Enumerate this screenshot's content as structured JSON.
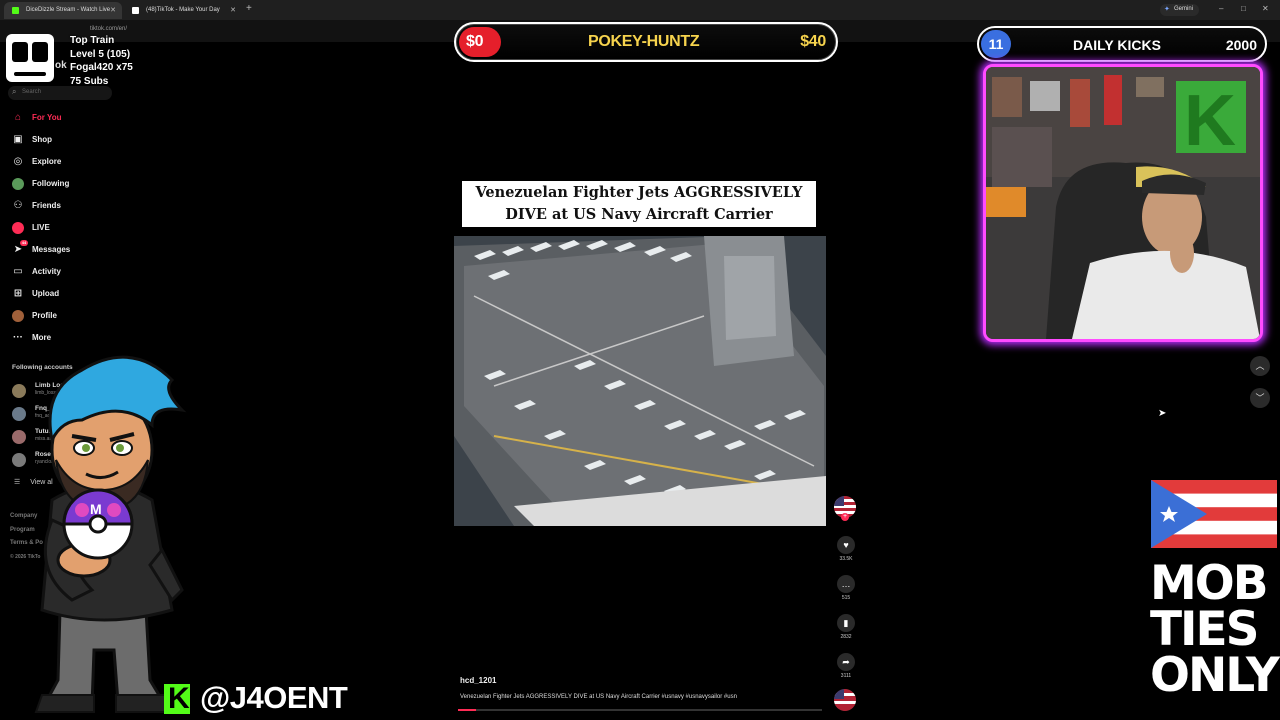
{
  "browser": {
    "tabs": [
      {
        "title": "DiceDizzle Stream - Watch Live",
        "favicon_color": "#53fc18",
        "active": true
      },
      {
        "title": "(48)TikTok - Make Your Day",
        "favicon_color": "#ffffff",
        "active": false
      }
    ],
    "new_tab": "+",
    "gemini_label": "Gemini",
    "url": "tiktok.com/en/"
  },
  "overlay_train": {
    "line1": "Top Train",
    "line2": "Level 5  (105)",
    "line3": "Fogal420 x75",
    "line4": "75 Subs",
    "logo_text": "ok"
  },
  "sidebar": {
    "search_placeholder": "Search",
    "items": [
      {
        "label": "For You",
        "icon": "home-icon",
        "active": true
      },
      {
        "label": "Shop",
        "icon": "shop-icon"
      },
      {
        "label": "Explore",
        "icon": "compass-icon"
      },
      {
        "label": "Following",
        "icon": "following-icon"
      },
      {
        "label": "Friends",
        "icon": "friends-icon"
      },
      {
        "label": "LIVE",
        "icon": "live-icon"
      },
      {
        "label": "Messages",
        "icon": "messages-icon",
        "badge": "44"
      },
      {
        "label": "Activity",
        "icon": "activity-icon"
      },
      {
        "label": "Upload",
        "icon": "upload-icon"
      },
      {
        "label": "Profile",
        "icon": "profile-icon"
      },
      {
        "label": "More",
        "icon": "more-icon"
      }
    ],
    "following_title": "Following accounts",
    "accounts": [
      {
        "name": "Limb Loss Bos",
        "handle": "limb_loss_boss"
      },
      {
        "name": "Fnq_advent",
        "handle": "fnq_adventures"
      },
      {
        "name": "Tutu.sh",
        "handle": "miss.am"
      },
      {
        "name": "Rosecle",
        "handle": "ryancloneb"
      }
    ],
    "view_all": "View al",
    "footer": [
      "Company",
      "Program",
      "Terms & Po",
      "© 2026 TikTo"
    ]
  },
  "streamer": {
    "handle": "@J4OENT"
  },
  "goal_bar": {
    "left_amount": "$0",
    "name": "POKEY-HUNTZ",
    "right_amount": "$40"
  },
  "daily_kicks": {
    "count": "11",
    "title": "DAILY KICKS",
    "goal": "2000"
  },
  "video": {
    "title_line1": "Venezuelan Fighter Jets AGGRESSIVELY",
    "title_line2": "DIVE at US Navy Aircraft Carrier",
    "author": "hcd_1201",
    "caption": "Venezuelan Fighter Jets AGGRESSIVELY DIVE at US Navy Aircraft Carrier #usnavy #usnavysailor #usn",
    "progress": 0.05
  },
  "actions": {
    "likes": "33.5K",
    "comments": "515",
    "saves": "2832",
    "shares": "3111"
  },
  "branding": {
    "mob_line1": "MOB",
    "mob_line2": "TIES",
    "mob_line3": "ONLY"
  },
  "colors": {
    "tiktok_accent": "#fe2c55",
    "kick_green": "#53fc18",
    "goal_yellow": "#f6d34d",
    "cam_glow": "#ff4bff"
  }
}
